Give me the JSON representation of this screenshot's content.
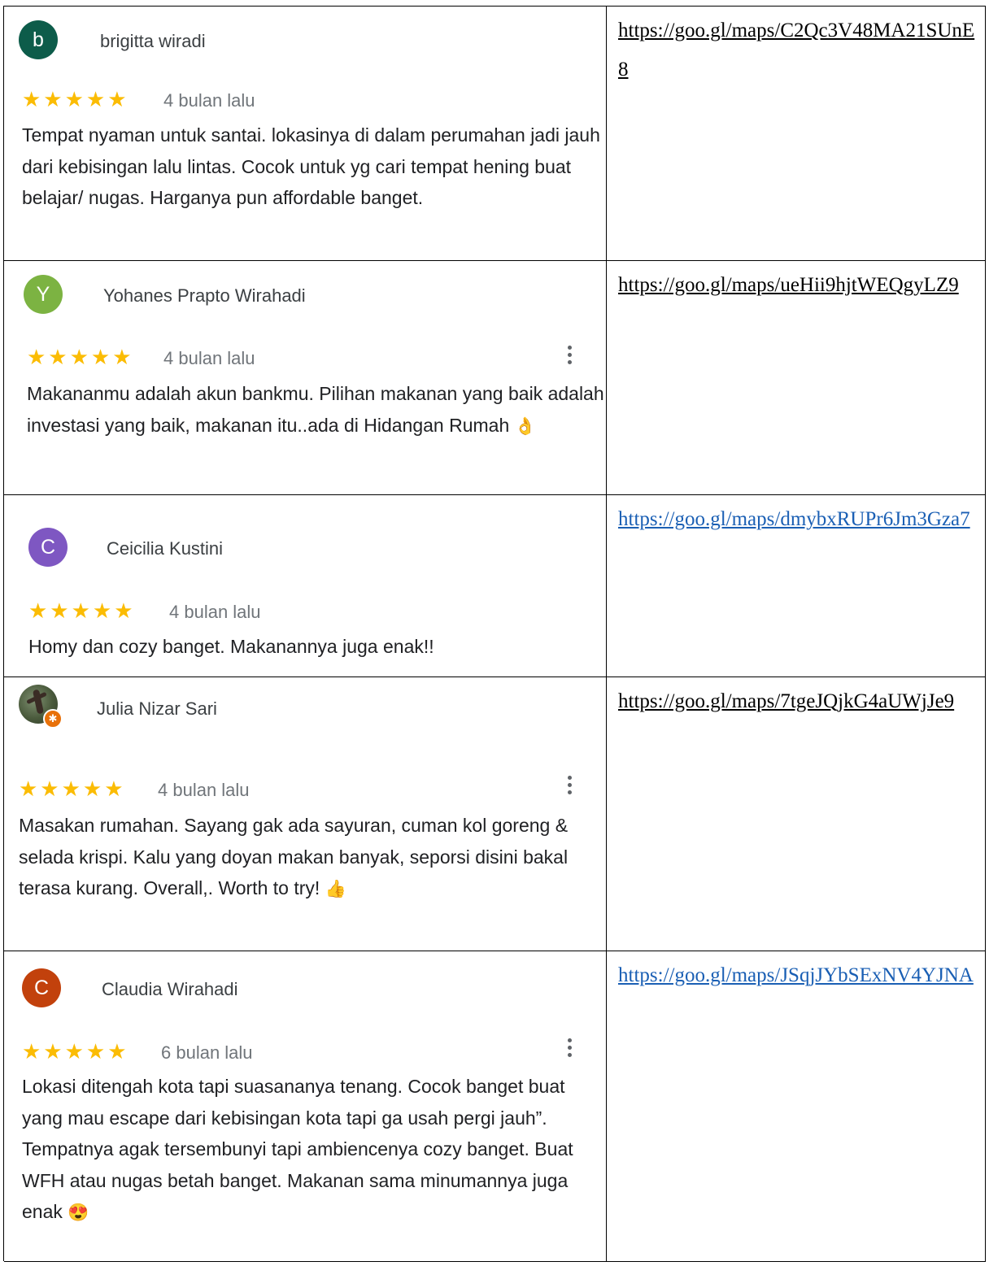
{
  "reviews": [
    {
      "initial": "b",
      "avatar_color": "#0d5c4a",
      "name": "brigitta wiradi",
      "stars": "★★★★★",
      "time": "4 bulan lalu",
      "text": "Tempat nyaman untuk santai. lokasinya di dalam perumahan jadi jauh dari kebisingan lalu lintas. Cocok untuk yg cari tempat hening buat belajar/ nugas. Harganya pun affordable banget.",
      "link": "https://goo.gl/maps/C2Qc3V48MA21SUnE8",
      "link_color": "#000000",
      "has_menu": false
    },
    {
      "initial": "Y",
      "avatar_color": "#7cb342",
      "name": "Yohanes Prapto Wirahadi",
      "stars": "★★★★★",
      "time": "4 bulan lalu",
      "text": "Makananmu adalah akun bankmu. Pilihan makanan yang baik adalah investasi yang baik, makanan itu..ada di Hidangan Rumah",
      "emoji": "👌",
      "link": "https://goo.gl/maps/ueHii9hjtWEQgyLZ9",
      "link_color": "#000000",
      "has_menu": true
    },
    {
      "initial": "C",
      "avatar_color": "#7e57c2",
      "name": "Ceicilia Kustini",
      "stars": "★★★★★",
      "time": "4 bulan lalu",
      "text": "Homy dan cozy banget. Makanannya juga enak!!",
      "link": "https://goo.gl/maps/dmybxRUPr6Jm3Gza7",
      "link_color": "#1a5fb4",
      "has_menu": false
    },
    {
      "initial": "",
      "avatar_color": "#4a5a3c",
      "name": "Julia Nizar Sari",
      "stars": "★★★★★",
      "time": "4 bulan lalu",
      "text": "Masakan rumahan. Sayang gak ada sayuran, cuman kol goreng & selada krispi. Kalu yang doyan makan banyak, seporsi disini bakal terasa kurang. Overall,. Worth to try!",
      "emoji": "👍",
      "link": "https://goo.gl/maps/7tgeJQjkG4aUWjJe9",
      "link_color": "#000000",
      "has_menu": true,
      "avatar_badge": "✱"
    },
    {
      "initial": "C",
      "avatar_color": "#c2410c",
      "name": "Claudia Wirahadi",
      "stars": "★★★★★",
      "time": "6 bulan lalu",
      "text": "Lokasi ditengah kota tapi suasananya tenang. Cocok banget buat yang mau escape dari kebisingan kota tapi ga usah pergi jauh”. Tempatnya agak tersembunyi tapi ambiencenya cozy banget. Buat WFH atau nugas betah banget. Makanan sama minumannya juga enak",
      "emoji": "😍",
      "link": "https://goo.gl/maps/JSqjJYbSExNV4YJNA",
      "link_color": "#1a5fb4",
      "has_menu": true
    }
  ]
}
